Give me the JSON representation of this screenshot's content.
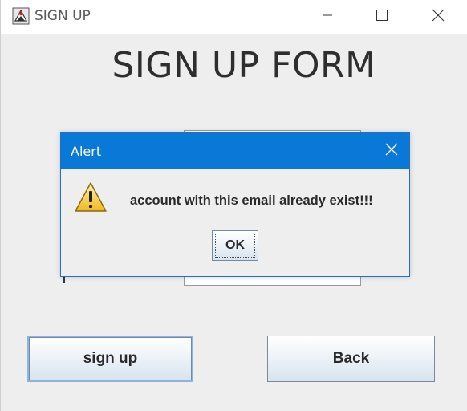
{
  "window": {
    "title": "SIGN UP",
    "app_icon": "java-duke-icon",
    "controls": [
      "minimize-icon",
      "maximize-icon",
      "close-icon"
    ]
  },
  "form": {
    "title": "SIGN UP FORM"
  },
  "buttons": {
    "signup_label": "sign up",
    "back_label": "Back"
  },
  "dialog": {
    "title": "Alert",
    "message": "account with this email already exist!!!",
    "ok_label": "OK",
    "icon": "warning-icon"
  },
  "colors": {
    "dialog_titlebar": "#0a78d7",
    "window_bg": "#eeeeee",
    "warning_yellow": "#f4c430"
  }
}
